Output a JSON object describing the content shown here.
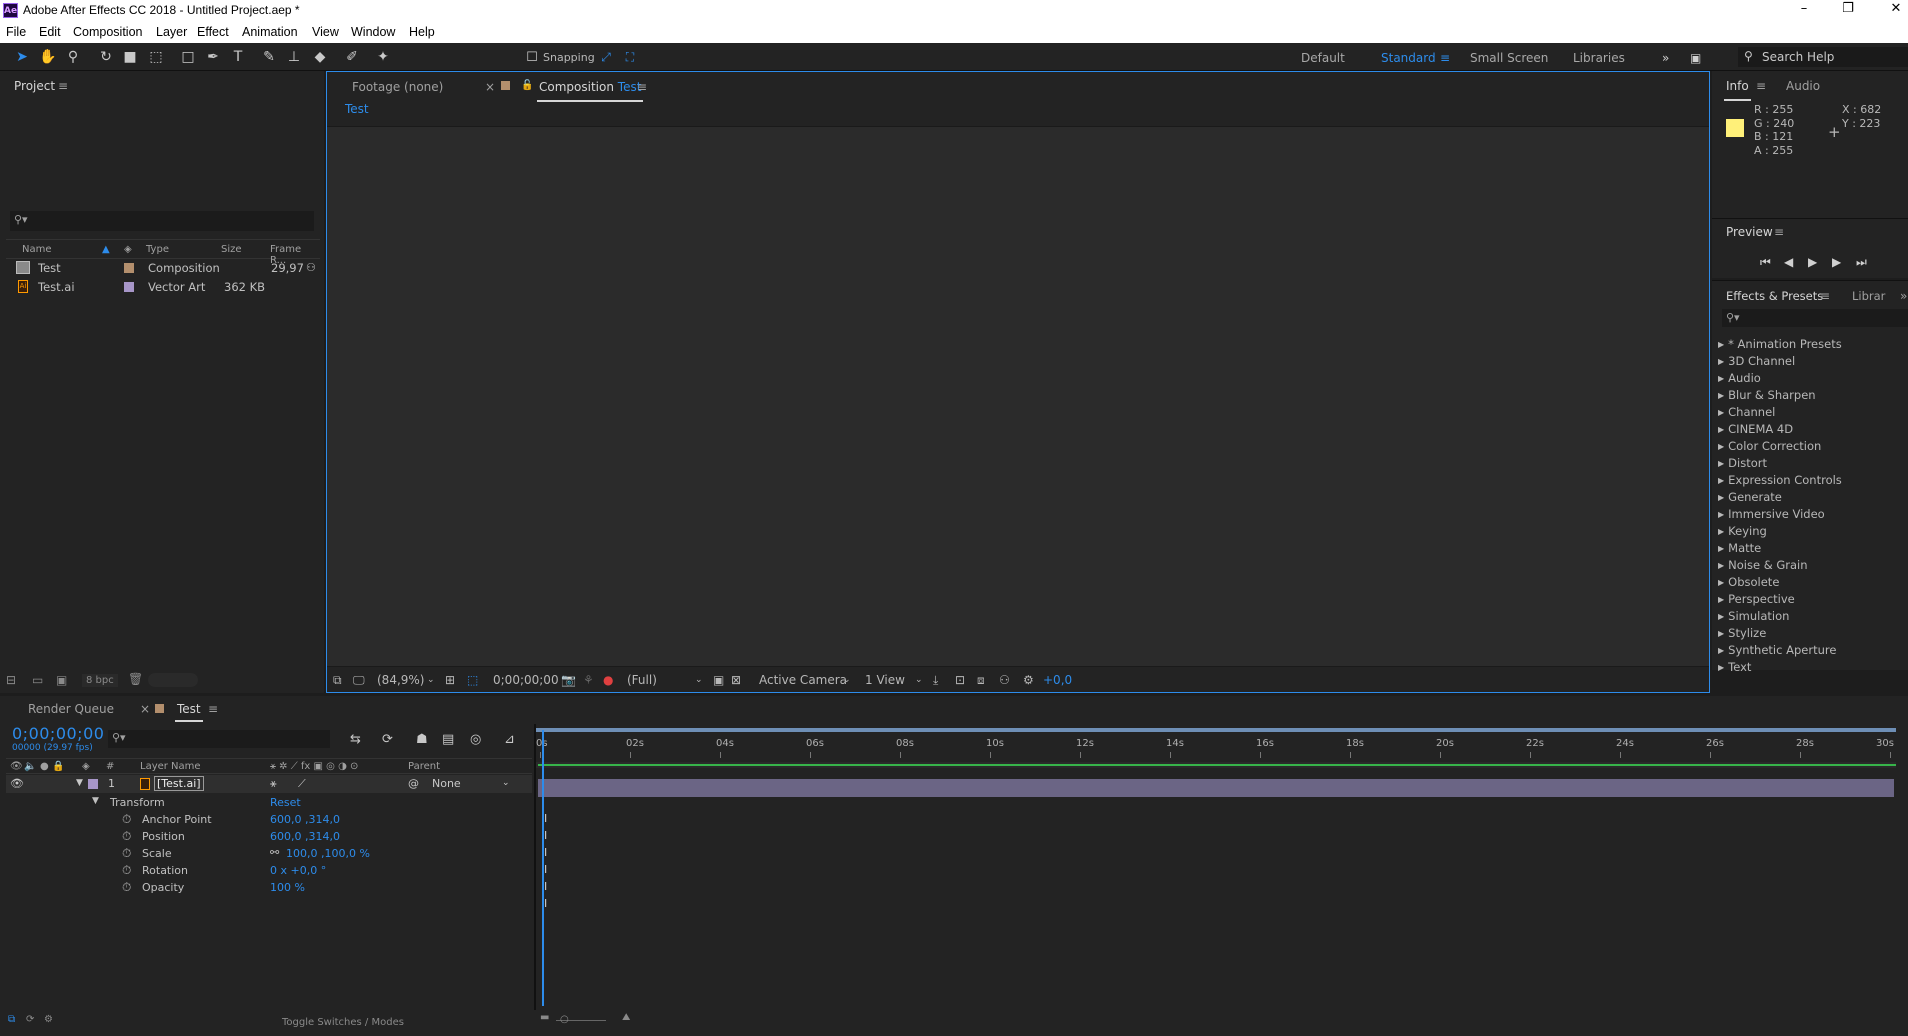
{
  "titlebar": {
    "app_icon": "Ae",
    "title": "Adobe After Effects CC 2018 - Untitled Project.aep *",
    "min": "–",
    "max": "❐",
    "close": "✕"
  },
  "menu": [
    "File",
    "Edit",
    "Composition",
    "Layer",
    "Effect",
    "Animation",
    "View",
    "Window",
    "Help"
  ],
  "toolbar": {
    "snapping_label": "Snapping",
    "workspaces": [
      "Default",
      "Standard",
      "Small Screen",
      "Libraries"
    ],
    "active_workspace": "Standard",
    "search_placeholder": "Search Help"
  },
  "project": {
    "tab": "Project",
    "columns": {
      "name": "Name",
      "type": "Type",
      "size": "Size",
      "frame_rate": "Frame R..."
    },
    "items": [
      {
        "name": "Test",
        "type": "Composition",
        "size": "",
        "frame_rate": "29,97",
        "label_color": "#b38f6d"
      },
      {
        "name": "Test.ai",
        "type": "Vector Art",
        "size": "362 KB",
        "frame_rate": "",
        "label_color": "#a796c8"
      }
    ],
    "bpc": "8 bpc"
  },
  "viewer": {
    "tabs": {
      "footage": "Footage (none)",
      "composition_prefix": "Composition",
      "composition_name": "Test"
    },
    "sub_tab": "Test",
    "zoom": "(84,9%)",
    "timecode": "0;00;00;00",
    "resolution": "(Full)",
    "camera": "Active Camera",
    "views": "1 View",
    "exposure": "+0,0"
  },
  "info": {
    "tabs": [
      "Info",
      "Audio"
    ],
    "r": "R : 255",
    "g": "G : 240",
    "b": "B : 121",
    "a": "A : 255",
    "x": "X : 682",
    "y": "Y : 223",
    "swatch_color": "#fff079"
  },
  "preview": {
    "tab": "Preview"
  },
  "effects": {
    "tabs": [
      "Effects & Presets",
      "Librar"
    ],
    "items": [
      "* Animation Presets",
      "3D Channel",
      "Audio",
      "Blur & Sharpen",
      "Channel",
      "CINEMA 4D",
      "Color Correction",
      "Distort",
      "Expression Controls",
      "Generate",
      "Immersive Video",
      "Keying",
      "Matte",
      "Noise & Grain",
      "Obsolete",
      "Perspective",
      "Simulation",
      "Stylize",
      "Synthetic Aperture",
      "Text"
    ]
  },
  "timeline": {
    "tabs": {
      "render_queue": "Render Queue",
      "comp": "Test"
    },
    "current_time": "0;00;00;00",
    "fps_line": "00000 (29.97 fps)",
    "columns": {
      "num": "#",
      "layer_name": "Layer Name",
      "parent": "Parent"
    },
    "layer": {
      "index": "1",
      "name": "[Test.ai]",
      "parent": "None"
    },
    "transform": {
      "label": "Transform",
      "reset": "Reset"
    },
    "properties": [
      {
        "name": "Anchor Point",
        "value": "600,0 ,314,0"
      },
      {
        "name": "Position",
        "value": "600,0 ,314,0"
      },
      {
        "name": "Scale",
        "value": "100,0 ,100,0 %"
      },
      {
        "name": "Rotation",
        "value": "0 x +0,0 °"
      },
      {
        "name": "Opacity",
        "value": "100 %"
      }
    ],
    "ruler_ticks": [
      "0s",
      "02s",
      "04s",
      "06s",
      "08s",
      "10s",
      "12s",
      "14s",
      "16s",
      "18s",
      "20s",
      "22s",
      "24s",
      "26s",
      "28s",
      "30s"
    ],
    "toggle_label": "Toggle Switches / Modes"
  }
}
